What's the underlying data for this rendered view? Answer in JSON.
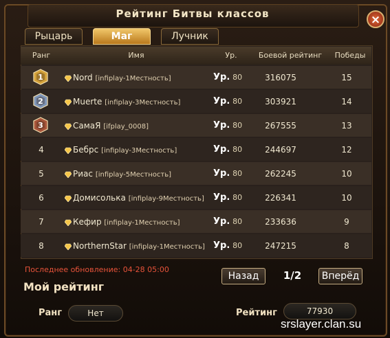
{
  "window": {
    "title": "Рейтинг Битвы классов",
    "close_icon": "×"
  },
  "tabs": [
    {
      "label": "Рыцарь",
      "active": false
    },
    {
      "label": "Маг",
      "active": true
    },
    {
      "label": "Лучник",
      "active": false
    }
  ],
  "table": {
    "columns": [
      "Ранг",
      "Имя",
      "Ур.",
      "Боевой рейтинг",
      "Победы"
    ],
    "level_prefix": "Ур.",
    "rows": [
      {
        "rank": "1",
        "name": "Nord",
        "guild": "[infiplay-1Местность]",
        "level": "80",
        "rating": "316075",
        "wins": "15",
        "medal": "gold-medal"
      },
      {
        "rank": "2",
        "name": "Muerte",
        "guild": "[infiplay-3Местность]",
        "level": "80",
        "rating": "303921",
        "wins": "14",
        "medal": "silver-medal"
      },
      {
        "rank": "3",
        "name": "СамаЯ",
        "guild": "[ifplay_0008]",
        "level": "80",
        "rating": "267555",
        "wins": "13",
        "medal": "bronze-medal"
      },
      {
        "rank": "4",
        "name": "Бебрс",
        "guild": "[infiplay-3Местность]",
        "level": "80",
        "rating": "244697",
        "wins": "12",
        "medal": ""
      },
      {
        "rank": "5",
        "name": "Риас",
        "guild": "[infiplay-5Местность]",
        "level": "80",
        "rating": "262245",
        "wins": "10",
        "medal": ""
      },
      {
        "rank": "6",
        "name": "Домисолька",
        "guild": "[infiplay-9Местность]",
        "level": "80",
        "rating": "226341",
        "wins": "10",
        "medal": ""
      },
      {
        "rank": "7",
        "name": "Кефир",
        "guild": "[infiplay-1Местность]",
        "level": "80",
        "rating": "233636",
        "wins": "9",
        "medal": ""
      },
      {
        "rank": "8",
        "name": "NorthernStar",
        "guild": "[infiplay-1Местность]",
        "level": "80",
        "rating": "247215",
        "wins": "8",
        "medal": ""
      }
    ]
  },
  "footer": {
    "last_update": "Последнее обновление: 04-28 05:00",
    "back_label": "Назад",
    "page": "1/2",
    "next_label": "Вперёд"
  },
  "my_rating": {
    "title": "Мой рейтинг",
    "rank_label": "Ранг",
    "rank_value": "Нет",
    "rating_label": "Рейтинг",
    "rating_value": "77930"
  },
  "watermark": "srslayer.clan.su",
  "colors": {
    "accent": "#f1c76a",
    "update_text": "#e7533a",
    "gold": "#d4a23a",
    "silver": "#7f96b8",
    "bronze": "#a8553a"
  }
}
